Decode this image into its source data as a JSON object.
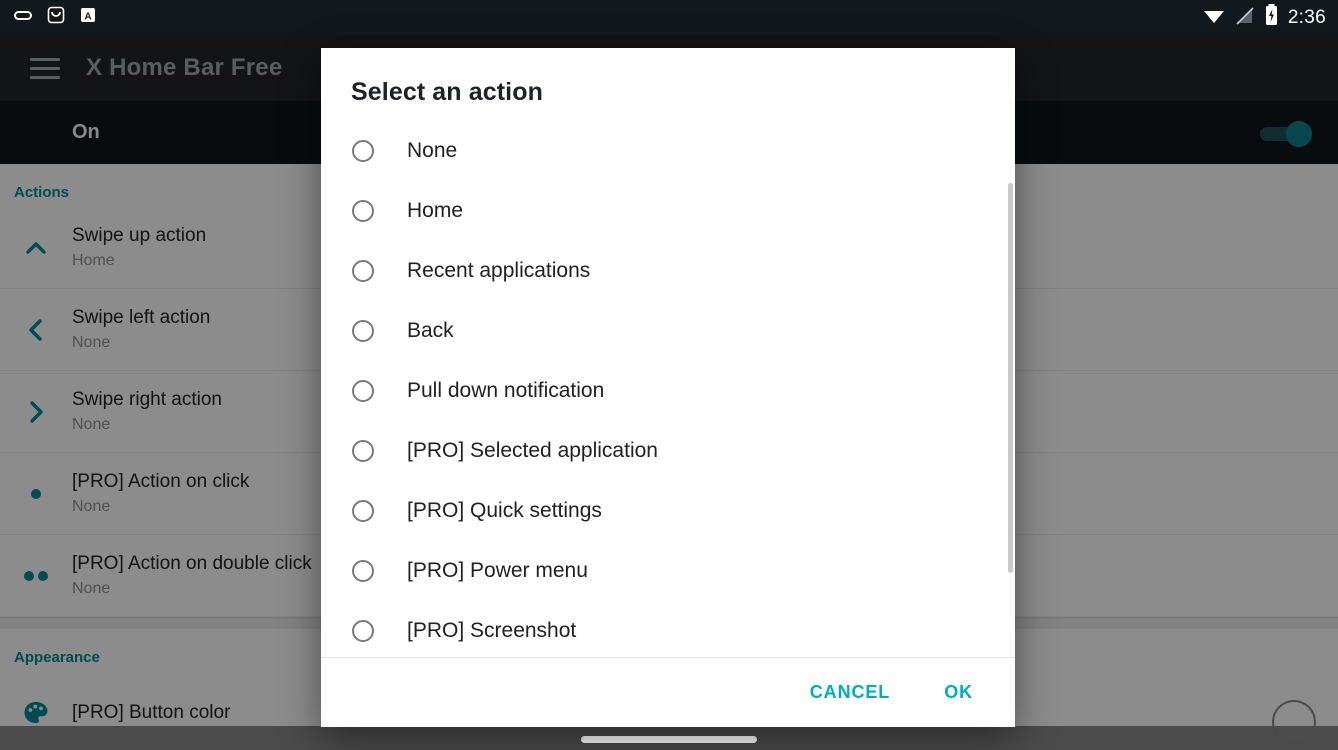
{
  "statusbar": {
    "icons_left": [
      "capsule-icon",
      "inbox-icon",
      "letter-a-icon"
    ],
    "icons_right": [
      "wifi-icon",
      "signal-off-icon",
      "battery-charging-icon"
    ],
    "clock": "2:36"
  },
  "appbar": {
    "menu_icon": "hamburger-menu-icon",
    "title": "X Home Bar Free"
  },
  "master_switch": {
    "label": "On",
    "state": "on",
    "accent_color": "#0f7b87"
  },
  "prefs": {
    "sections": [
      {
        "title": "Actions",
        "rows": [
          {
            "icon": "chevron-up-icon",
            "title": "Swipe up action",
            "value": "Home"
          },
          {
            "icon": "chevron-left-icon",
            "title": "Swipe left action",
            "value": "None"
          },
          {
            "icon": "chevron-right-icon",
            "title": "Swipe right action",
            "value": "None"
          },
          {
            "icon": "single-dot-icon",
            "title": "[PRO] Action on click",
            "value": "None"
          },
          {
            "icon": "double-dot-icon",
            "title": "[PRO] Action on double click",
            "value": "None"
          }
        ]
      },
      {
        "title": "Appearance",
        "rows": [
          {
            "icon": "palette-icon",
            "title": "[PRO] Button color",
            "value": ""
          }
        ]
      }
    ],
    "section_color": "#00838f"
  },
  "dialog": {
    "title": "Select an action",
    "options": [
      {
        "label": "None",
        "selected": false
      },
      {
        "label": "Home",
        "selected": false
      },
      {
        "label": "Recent applications",
        "selected": false
      },
      {
        "label": "Back",
        "selected": false
      },
      {
        "label": "Pull down notification",
        "selected": false
      },
      {
        "label": "[PRO] Selected application",
        "selected": false
      },
      {
        "label": "[PRO] Quick settings",
        "selected": false
      },
      {
        "label": "[PRO] Power menu",
        "selected": false
      },
      {
        "label": "[PRO] Screenshot",
        "selected": false
      }
    ],
    "cancel_label": "CANCEL",
    "ok_label": "OK",
    "button_color": "#00acc1"
  },
  "navbar": {
    "pill_icon": "home-pill-icon",
    "fab_icon": "circle-outline-icon"
  }
}
